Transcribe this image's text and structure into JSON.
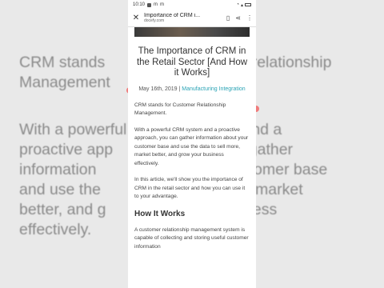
{
  "status_bar": {
    "time": "10:10"
  },
  "browser": {
    "page_title": "Importance of CRM i...",
    "domain": "docefy.com"
  },
  "article": {
    "title": "The Importance of CRM in the Retail Sector [And How it Works]",
    "date": "May 16th, 2019",
    "separator": " | ",
    "category": "Manufacturing Integration",
    "paragraphs": [
      "CRM stands for Customer Relationship Management.",
      "With a powerful CRM system and a proactive approach, you can gather information about your customer base and use the data to sell more, market better, and grow your business effectively.",
      "In this article, we'll show you the importance of CRM in the retail sector and how you can use it to your advantage."
    ],
    "section_heading": "How It Works",
    "section_paragraph": "A customer relationship management system is capable of collecting and storing useful customer information"
  },
  "background_text": {
    "line1": "CRM stands",
    "line1b": "relationship",
    "line2": "Management",
    "line3": "With a powerful",
    "line3b": "m and a",
    "line4": "proactive app",
    "line4b": "n gather",
    "line5": "information",
    "line5b": "stomer base",
    "line6": "and use the",
    "line6b": "e, market",
    "line7": "better, and g",
    "line7b": "ess",
    "line8": "effectively."
  }
}
